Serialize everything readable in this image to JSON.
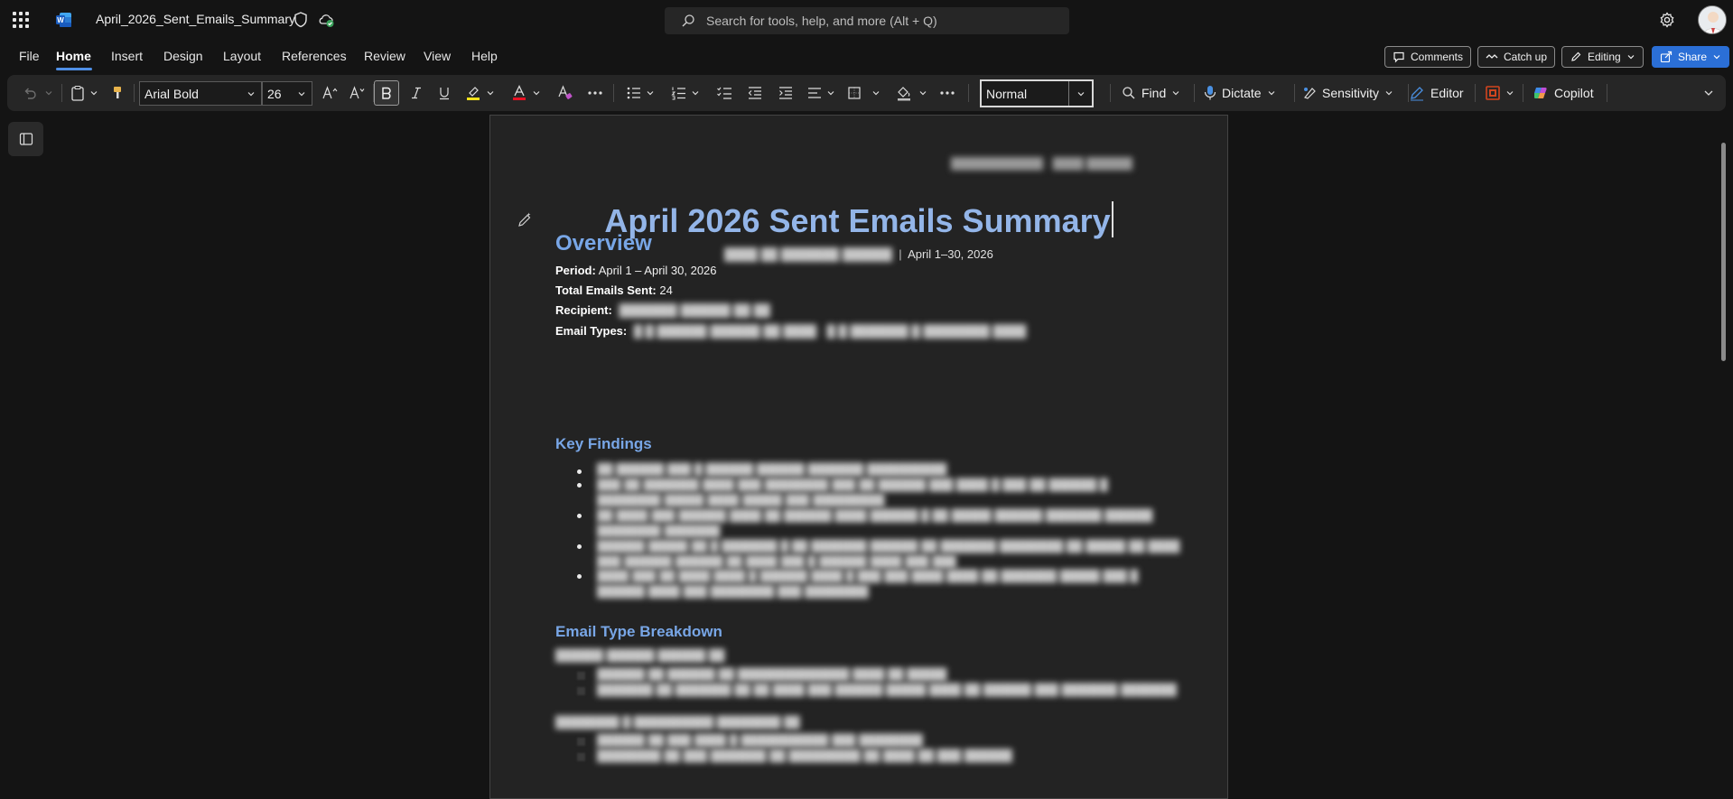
{
  "app": {
    "document_title": "April_2026_Sent_Emails_Summary",
    "search_placeholder": "Search for tools, help, and more (Alt + Q)"
  },
  "menu": {
    "tabs": [
      "File",
      "Home",
      "Insert",
      "Design",
      "Layout",
      "References",
      "Review",
      "View",
      "Help"
    ],
    "active_tab": "Home",
    "comments_label": "Comments",
    "catchup_label": "Catch up",
    "editing_label": "Editing",
    "share_label": "Share"
  },
  "ribbon": {
    "font_name": "Arial Bold",
    "font_size": "26",
    "style": "Normal",
    "find_label": "Find",
    "dictate_label": "Dictate",
    "sensitivity_label": "Sensitivity",
    "editor_label": "Editor",
    "copilot_label": "Copilot"
  },
  "colors": {
    "accent": "#4f8fe6",
    "heading": "#78a6e6",
    "title": "#93b5e8",
    "share": "#2b6fd6"
  },
  "document": {
    "title": "April 2026 Sent Emails Summary",
    "date_range": "April 1–30, 2026",
    "overview_heading": "Overview",
    "period_label": "Period:",
    "period_value": "April 1 – April 30, 2026",
    "total_label": "Total Emails Sent:",
    "total_value": "24",
    "recipient_label": "Recipient:",
    "types_label": "Email Types:",
    "key_findings_heading": "Key Findings",
    "breakdown_heading": "Email Type Breakdown"
  }
}
